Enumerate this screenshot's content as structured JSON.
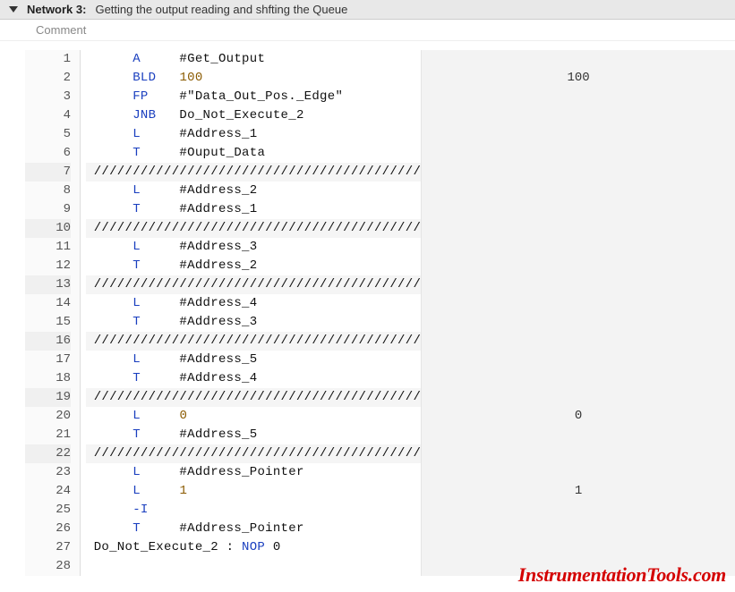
{
  "header": {
    "network_label": "Network 3:",
    "title": "Getting the output reading and shfting the Queue"
  },
  "comment_placeholder": "Comment",
  "lines": [
    {
      "n": 1,
      "op": "A",
      "arg": "#Get_Output",
      "val": ""
    },
    {
      "n": 2,
      "op": "BLD",
      "arg": "100",
      "arg_is_num": true,
      "val": "100"
    },
    {
      "n": 3,
      "op": "FP",
      "arg": "#\"Data_Out_Pos._Edge\"",
      "val": ""
    },
    {
      "n": 4,
      "op": "JNB",
      "arg": "Do_Not_Execute_2",
      "val": ""
    },
    {
      "n": 5,
      "op": "L",
      "arg": "#Address_1",
      "val": ""
    },
    {
      "n": 6,
      "op": "T",
      "arg": "#Ouput_Data",
      "val": ""
    },
    {
      "n": 7,
      "divider": true
    },
    {
      "n": 8,
      "op": "L",
      "arg": "#Address_2",
      "val": ""
    },
    {
      "n": 9,
      "op": "T",
      "arg": "#Address_1",
      "val": ""
    },
    {
      "n": 10,
      "divider": true
    },
    {
      "n": 11,
      "op": "L",
      "arg": "#Address_3",
      "val": ""
    },
    {
      "n": 12,
      "op": "T",
      "arg": "#Address_2",
      "val": ""
    },
    {
      "n": 13,
      "divider": true
    },
    {
      "n": 14,
      "op": "L",
      "arg": "#Address_4",
      "val": ""
    },
    {
      "n": 15,
      "op": "T",
      "arg": "#Address_3",
      "val": ""
    },
    {
      "n": 16,
      "divider": true
    },
    {
      "n": 17,
      "op": "L",
      "arg": "#Address_5",
      "val": ""
    },
    {
      "n": 18,
      "op": "T",
      "arg": "#Address_4",
      "val": ""
    },
    {
      "n": 19,
      "divider": true
    },
    {
      "n": 20,
      "op": "L",
      "arg": "0",
      "arg_is_num": true,
      "val": "0"
    },
    {
      "n": 21,
      "op": "T",
      "arg": "#Address_5",
      "val": ""
    },
    {
      "n": 22,
      "divider": true
    },
    {
      "n": 23,
      "op": "L",
      "arg": "#Address_Pointer",
      "val": ""
    },
    {
      "n": 24,
      "op": "L",
      "arg": "1",
      "arg_is_num": true,
      "val": "1"
    },
    {
      "n": 25,
      "op": "-I",
      "arg": "",
      "val": ""
    },
    {
      "n": 26,
      "op": "T",
      "arg": "#Address_Pointer",
      "val": ""
    },
    {
      "n": 27,
      "label_line": "Do_Not_Execute_2 : NOP 0"
    },
    {
      "n": 28,
      "empty": true
    }
  ],
  "divider_text": "//////////////////////////////////////////",
  "watermark": "InstrumentationTools.com"
}
